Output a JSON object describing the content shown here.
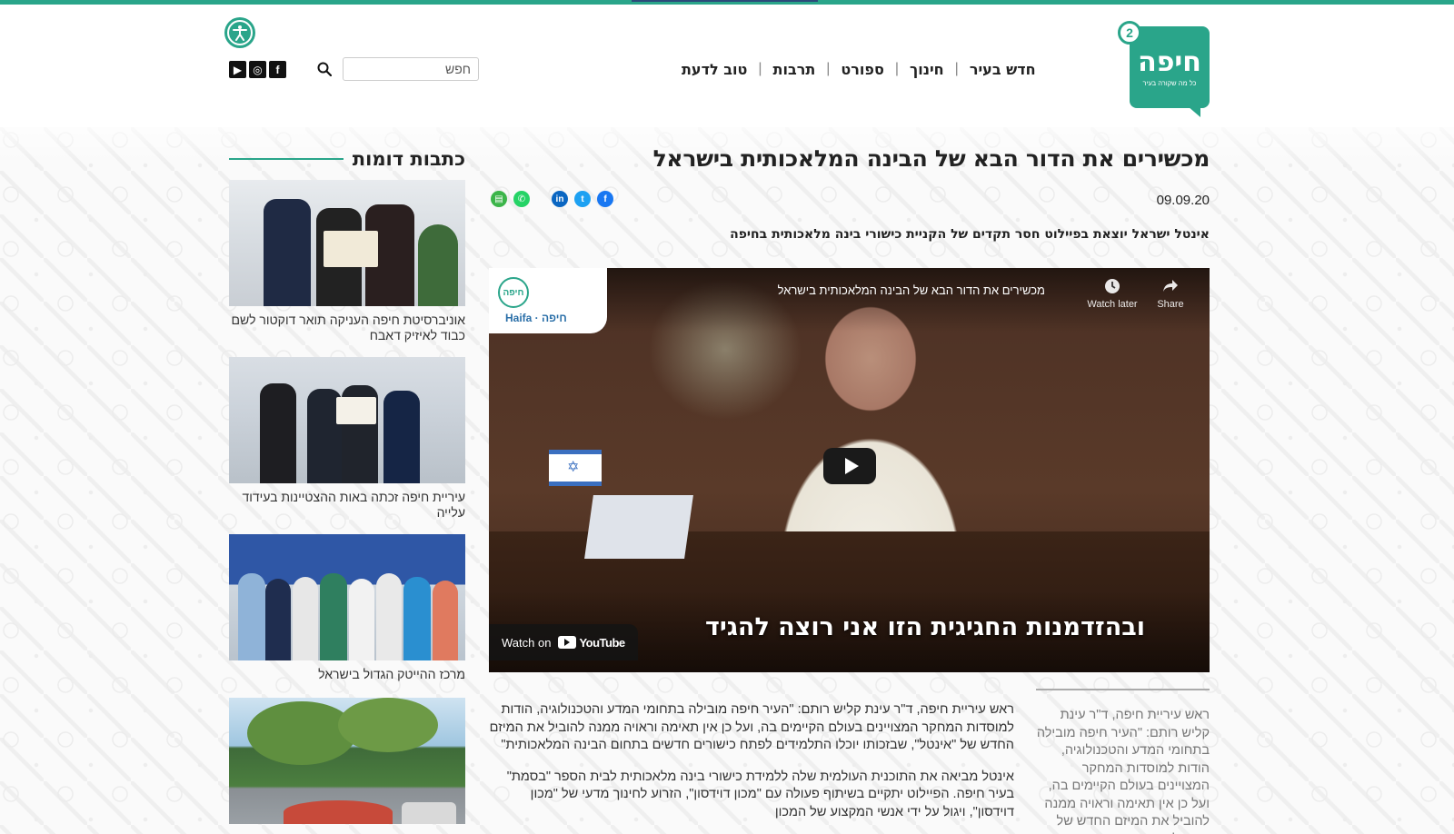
{
  "site": {
    "logo_text": "חיפה",
    "logo_subtitle": "כל מה שקורה בעיר",
    "logo_badge": "2",
    "brand_color": "#2aa58a"
  },
  "nav": {
    "items": [
      "חדש בעיר",
      "חינוך",
      "ספורט",
      "תרבות",
      "טוב לדעת"
    ]
  },
  "search": {
    "value": "חפש"
  },
  "socials": [
    {
      "icon": "facebook-icon",
      "glyph": "f"
    },
    {
      "icon": "instagram-icon",
      "glyph": "◎"
    },
    {
      "icon": "youtube-icon",
      "glyph": "▶"
    }
  ],
  "article": {
    "title": "מכשירים את הדור הבא של הבינה המלאכותית בישראל",
    "date": "09.09.20",
    "lead": "אינטל ישראל יוצאת בפיילוט חסר תקדים של הקניית כישורי בינה מלאכותית בחיפה",
    "paragraphs": [
      "ראש עיריית חיפה, ד\"ר עינת קליש רותם: \"העיר חיפה מובילה בתחומי המדע והטכנולוגיה, הודות למוסדות המחקר המצויינים בעולם הקיימים בה, ועל כן אין תאימה וראויה ממנה להוביל את המיזם החדש של \"אינטל\", שבזכותו יוכלו התלמידים לפתח כישורים חדשים בתחום הבינה המלאכותית\"",
      "אינטל מביאה את התוכנית העולמית שלה ללמידת כישורי בינה מלאכותית לבית הספר \"בסמת\" בעיר חיפה. הפיילוט יתקיים בשיתוף פעולה עם \"מכון דוידסון\", הזרוע לחינוך מדעי של \"מכון דוידסון\", ויגול על ידי אנשי המקצוע של המכון"
    ],
    "pull_quote": "ראש עיריית חיפה, ד\"ר עינת קליש רותם: \"העיר חיפה מובילה בתחומי המדע והטכנולוגיה, הודות למוסדות המחקר המצויינים בעולם הקיימים בה, ועל כן אין תאימה וראויה ממנה להוביל את המיזם החדש של \"אינטל\""
  },
  "share": [
    {
      "icon": "facebook-share-icon",
      "glyph": "f",
      "color": "#1877f2"
    },
    {
      "icon": "twitter-share-icon",
      "glyph": "t",
      "color": "#1da1f2"
    },
    {
      "icon": "linkedin-share-icon",
      "glyph": "in",
      "color": "#0a66c2"
    },
    {
      "icon": "whatsapp-share-icon",
      "glyph": "✆",
      "color": "#25d366"
    },
    {
      "icon": "print-share-icon",
      "glyph": "▤",
      "color": "#3cb54a"
    }
  ],
  "video": {
    "title": "מכשירים את הדור הבא של הבינה המלאכותית בישראל",
    "channel_avatar": "חיפה",
    "channel_logo": "Haifa · חיפה",
    "watch_later": "Watch later",
    "share": "Share",
    "subtitle": "ובהזדמנות החגיגית הזו אני רוצה להגיד",
    "watch_on": "Watch on",
    "youtube": "YouTube"
  },
  "sidebar": {
    "title": "כתבות דומות",
    "items": [
      {
        "caption": "אוניברסיטת חיפה העניקה תואר דוקטור לשם כבוד לאיזיק דאבח"
      },
      {
        "caption": "עיריית חיפה זכתה באות ההצטיינות בעידוד עלייה"
      },
      {
        "caption": "מרכז ההייטק הגדול בישראל"
      },
      {
        "caption": ""
      }
    ]
  }
}
